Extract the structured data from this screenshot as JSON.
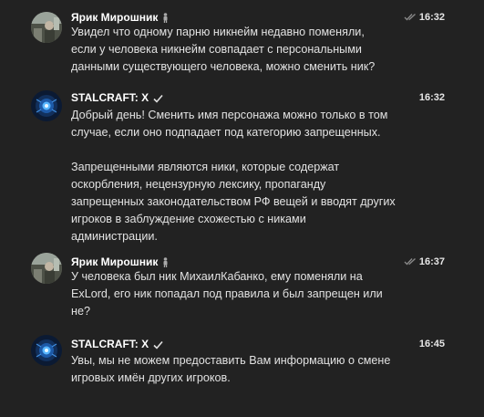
{
  "colors": {
    "background": "#222222",
    "text": "#e2e2e2",
    "author": "#ffffff",
    "read_ticks": "#8a8a8a"
  },
  "messages": [
    {
      "author": "Ярик Мирошник",
      "author_icon": "figure-icon",
      "time": "16:32",
      "status_icon": "double-check-read-icon",
      "lines": [
        "Увидел что одному парню никнейм недавно поменяли,",
        "если у человека никнейм совпадает с персональными",
        "данными существующего человека, можно сменить ник?"
      ]
    },
    {
      "author": "STALCRAFT: X",
      "author_icon": "verified-check-icon",
      "time": "16:32",
      "lines": [
        "Добрый день! Сменить имя персонажа можно только в том",
        "случае, если оно подпадает под категорию запрещенных.",
        "",
        "Запрещенными являются ники, которые содержат",
        "оскорбления, нецензурную лексику, пропаганду",
        "запрещенных законодательством РФ вещей и вводят других",
        "игроков в заблуждение схожестью с никами",
        "администрации."
      ]
    },
    {
      "author": "Ярик Мирошник",
      "author_icon": "figure-icon",
      "time": "16:37",
      "status_icon": "double-check-read-icon",
      "lines": [
        "У человека был ник МихаилКабанко, ему поменяли на",
        "ExLord, его ник попадал под правила и был запрещен или",
        "не?"
      ]
    },
    {
      "author": "STALCRAFT: X",
      "author_icon": "verified-check-icon",
      "time": "16:45",
      "lines": [
        "Увы, мы не можем предоставить Вам информацию о смене",
        "игровых имён других игроков."
      ]
    }
  ]
}
